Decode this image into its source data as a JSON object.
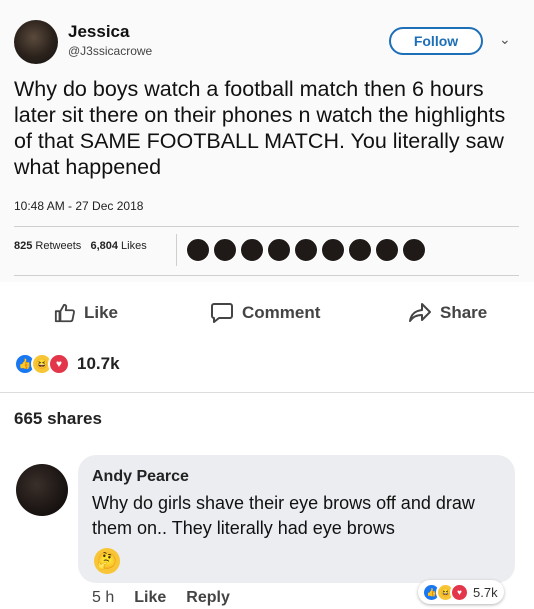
{
  "tweet": {
    "name": "Jessica",
    "handle": "@J3ssicacrowe",
    "follow_label": "Follow",
    "text": "Why do boys watch a football match then 6 hours later sit there on their phones n watch the highlights of that SAME FOOTBALL MATCH. You literally saw what happened",
    "timestamp": "10:48 AM - 27 Dec 2018",
    "retweets": "825",
    "retweets_label": "Retweets",
    "likes": "6,804",
    "likes_label": "Likes"
  },
  "post": {
    "actions": {
      "like": "Like",
      "comment": "Comment",
      "share": "Share"
    },
    "reaction_count": "10.7k",
    "shares": "665 shares"
  },
  "comment": {
    "author": "Andy Pearce",
    "text": "Why do girls shave their eye brows off and draw them on.. They literally had eye brows",
    "time": "5 h",
    "like_label": "Like",
    "reply_label": "Reply",
    "reaction_count": "5.7k"
  },
  "colors": {
    "accent": "#1d6fb8",
    "like": "#1877f2",
    "love": "#e4364a",
    "haha": "#f7c536"
  }
}
